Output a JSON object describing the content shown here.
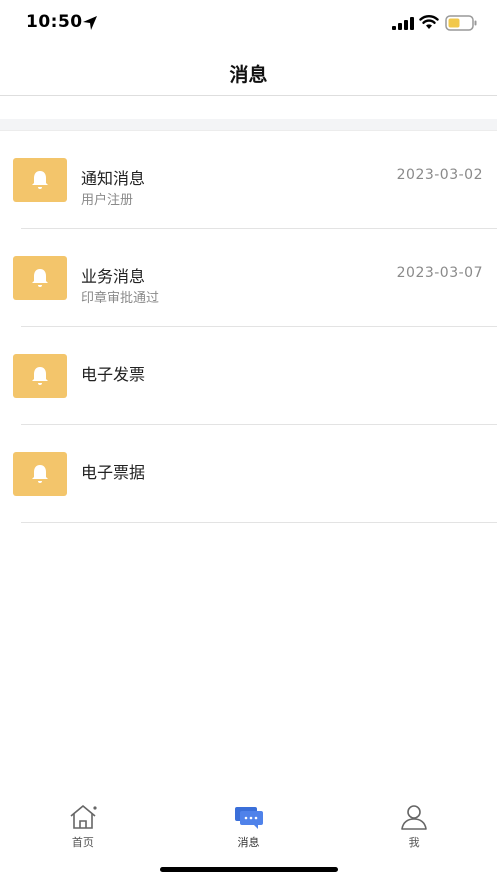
{
  "status_bar": {
    "time": "10:50"
  },
  "nav": {
    "title": "消息"
  },
  "messages": [
    {
      "title": "通知消息",
      "subtitle": "用户注册",
      "date": "2023-03-02"
    },
    {
      "title": "业务消息",
      "subtitle": "印章审批通过",
      "date": "2023-03-07"
    },
    {
      "title": "电子发票",
      "subtitle": "",
      "date": ""
    },
    {
      "title": "电子票据",
      "subtitle": "",
      "date": ""
    }
  ],
  "tabs": [
    {
      "label": "首页",
      "icon": "home-icon"
    },
    {
      "label": "消息",
      "icon": "chat-icon",
      "active": true
    },
    {
      "label": "我",
      "icon": "user-icon"
    }
  ],
  "colors": {
    "bell_bg": "#f3c56b",
    "active_tab": "#3b6fd9",
    "battery": "#f1c84b"
  }
}
